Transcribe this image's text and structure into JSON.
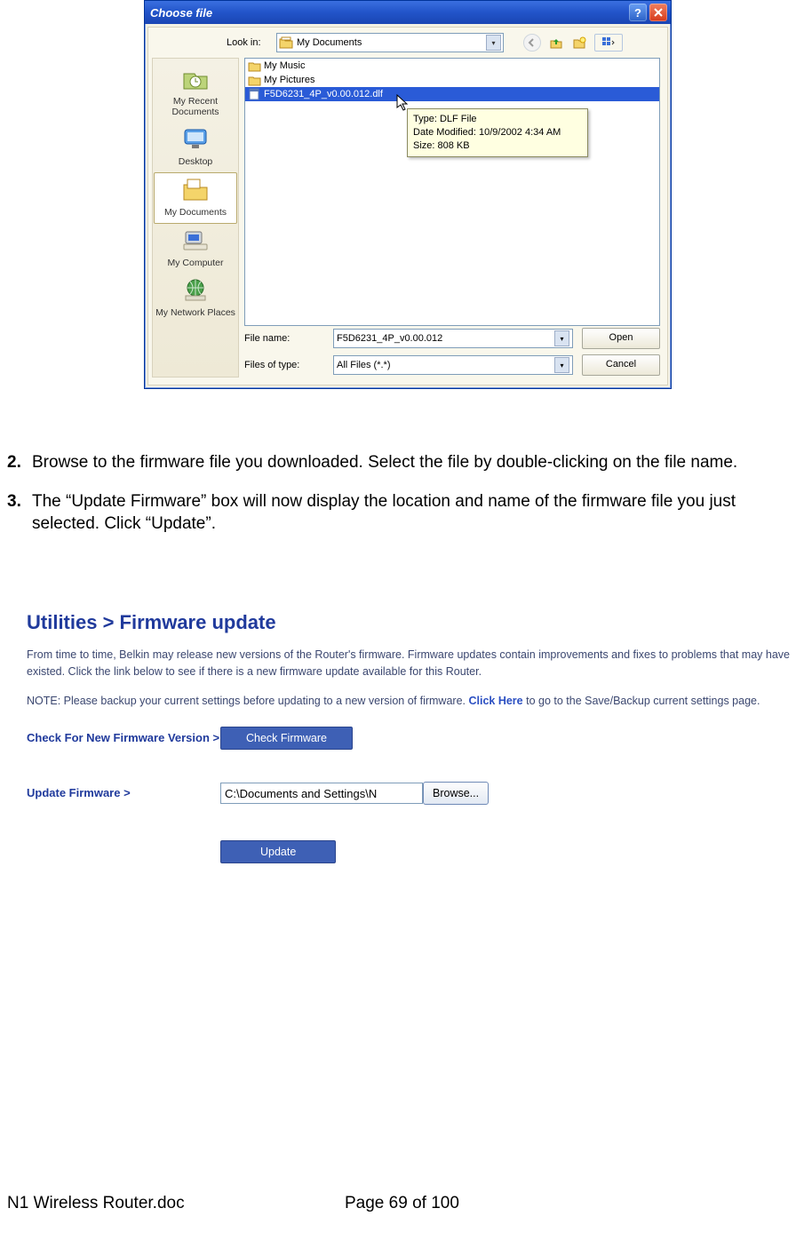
{
  "dialog": {
    "title": "Choose file",
    "look_in_label": "Look in:",
    "look_in_value": "My Documents",
    "places": [
      {
        "label": "My Recent Documents"
      },
      {
        "label": "Desktop"
      },
      {
        "label": "My Documents",
        "selected": true
      },
      {
        "label": "My Computer"
      },
      {
        "label": "My Network Places"
      }
    ],
    "files": [
      {
        "name": "My Music",
        "type": "folder"
      },
      {
        "name": "My Pictures",
        "type": "folder"
      },
      {
        "name": "F5D6231_4P_v0.00.012.dlf",
        "type": "file",
        "selected": true
      }
    ],
    "tooltip": {
      "line1": "Type: DLF File",
      "line2": "Date Modified: 10/9/2002 4:34 AM",
      "line3": "Size: 808 KB"
    },
    "file_name_label": "File name:",
    "file_name_value": "F5D6231_4P_v0.00.012",
    "file_type_label": "Files of type:",
    "file_type_value": "All Files (*.*)",
    "open_btn": "Open",
    "cancel_btn": "Cancel"
  },
  "steps": {
    "s2": {
      "num": "2.",
      "text": "Browse to the firmware file you downloaded. Select the file by double-clicking on the file name."
    },
    "s3": {
      "num": "3.",
      "text": "The “Update Firmware” box will now display the location and name of the firmware file you just selected. Click “Update”."
    }
  },
  "fw": {
    "title": "Utilities > Firmware update",
    "p1": "From time to time, Belkin may release new versions of the Router's firmware. Firmware updates contain improvements and fixes to problems that may have existed. Click the link below to see if there is a new firmware update available for this Router.",
    "p2_prefix": "NOTE: Please backup your current settings before updating to a new version of firmware. ",
    "p2_link": "Click Here",
    "p2_suffix": " to go to the Save/Backup current settings page.",
    "check_label": "Check For New Firmware Version >",
    "check_btn": "Check Firmware",
    "update_label": "Update Firmware >",
    "path_value": "C:\\Documents and Settings\\N",
    "browse_btn": "Browse...",
    "update_btn": "Update"
  },
  "footer": {
    "doc": "N1 Wireless Router.doc",
    "page": "Page 69 of 100"
  }
}
